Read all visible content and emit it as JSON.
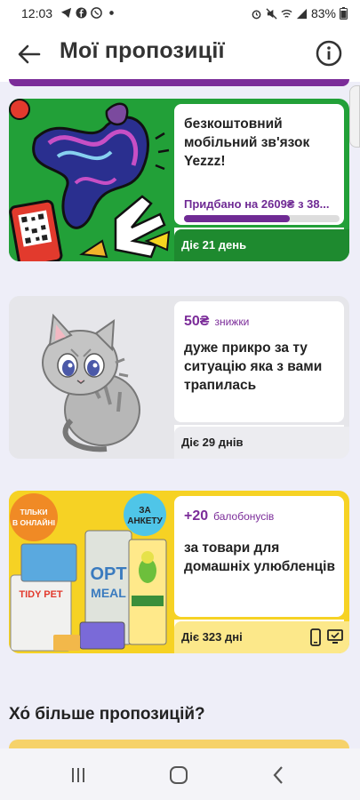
{
  "status_bar": {
    "time": "12:03",
    "battery": "83%"
  },
  "header": {
    "title": "Мої пропозиції"
  },
  "offers": [
    {
      "text": "безкоштовний мобільний зв'язок Yezzz!",
      "progress_text": "Придбано на 2609₴ з 38...",
      "progress_fraction": 0.68,
      "duration": "Діє 21 день",
      "bg_color": "#22a038"
    },
    {
      "badge_value": "50₴",
      "badge_label": "знижки",
      "text": "дуже прикро за ту ситуацію яка з вами трапилась",
      "duration": "Діє 29 днів",
      "bg_color": "#e6e6ea"
    },
    {
      "badge_value": "+20",
      "badge_label": "балобонусів",
      "text": "за товари для домашніх улюбленців",
      "duration": "Діє 323 дні",
      "img_tag_online": "ТІЛЬКИ В ОНЛАЙНІ",
      "img_tag_survey": "ЗА АНКЕТУ",
      "bg_color": "#f6d224"
    }
  ],
  "more_section": {
    "title": "Хо́ більше пропозицій?"
  },
  "colors": {
    "accent": "#7b2c99",
    "green": "#22a038",
    "yellow": "#f6d224"
  }
}
